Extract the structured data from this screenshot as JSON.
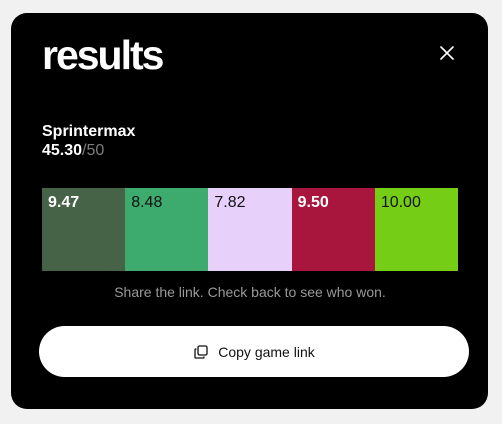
{
  "modal": {
    "title": "results",
    "close_icon": "close-icon"
  },
  "player": {
    "name": "Sprintermax",
    "score": "45.30",
    "separator": "/",
    "max": "50"
  },
  "rounds": [
    {
      "score": "9.47",
      "color": "#466348",
      "text_color": "#ffffff"
    },
    {
      "score": "8.48",
      "color": "#3cab6d",
      "text_color": "#111111"
    },
    {
      "score": "7.82",
      "color": "#e7d0f9",
      "text_color": "#111111"
    },
    {
      "score": "9.50",
      "color": "#a8163d",
      "text_color": "#ffffff"
    },
    {
      "score": "10.00",
      "color": "#75cd16",
      "text_color": "#111111"
    }
  ],
  "share": {
    "message": "Share the link. Check back to see who won."
  },
  "copy_button": {
    "label": "Copy game link",
    "icon": "copy-icon"
  }
}
